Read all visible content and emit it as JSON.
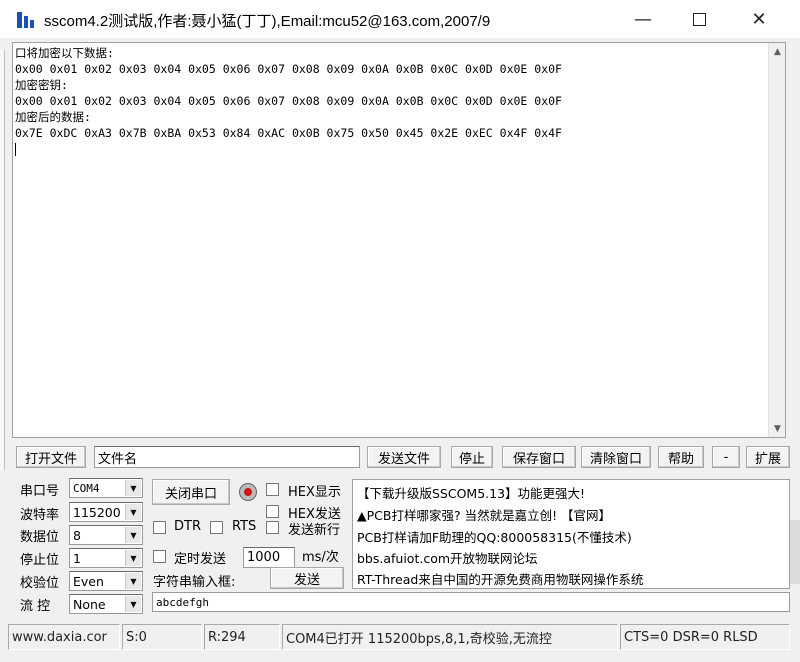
{
  "window": {
    "title": "sscom4.2测试版,作者:聂小猛(丁丁),Email:mcu52@163.com,2007/9",
    "min_glyph": "—",
    "close_glyph": "✕"
  },
  "terminal": {
    "lines": [
      "口将加密以下数据:",
      "0x00 0x01 0x02 0x03 0x04 0x05 0x06 0x07 0x08 0x09 0x0A 0x0B 0x0C 0x0D 0x0E 0x0F",
      "加密密钥:",
      "0x00 0x01 0x02 0x03 0x04 0x05 0x06 0x07 0x08 0x09 0x0A 0x0B 0x0C 0x0D 0x0E 0x0F",
      "加密后的数据:",
      "0x7E 0xDC 0xA3 0x7B 0xBA 0x53 0x84 0xAC 0x0B 0x75 0x50 0x45 0x2E 0xEC 0x4F 0x4F"
    ]
  },
  "toolbar": {
    "open_file": "打开文件",
    "filename": "文件名",
    "send_file": "发送文件",
    "stop": "停止",
    "save_window": "保存窗口",
    "clear_window": "清除窗口",
    "help": "帮助",
    "minus": "-",
    "expand": "扩展"
  },
  "serial": {
    "port_label": "串口号",
    "port_value": "COM4",
    "baud_label": "波特率",
    "baud_value": "115200",
    "databits_label": "数据位",
    "databits_value": "8",
    "stopbits_label": "停止位",
    "stopbits_value": "1",
    "parity_label": "校验位",
    "parity_value": "Even",
    "flow_label": "流 控",
    "flow_value": "None"
  },
  "controls": {
    "close_port": "关闭串口",
    "hex_display": "HEX显示",
    "hex_send": "HEX发送",
    "dtr": "DTR",
    "rts": "RTS",
    "send_newline": "发送新行",
    "timed_send": "定时发送",
    "interval": "1000",
    "interval_unit": "ms/次",
    "string_input": "字符串输入框:",
    "send": "发送",
    "send_text": "abcdefgh"
  },
  "info": {
    "lines": [
      "【下载升级版SSCOM5.13】功能更强大!",
      "▲PCB打样哪家强? 当然就是嘉立创! 【官网】",
      "PCB打样请加F助理的QQ:800058315(不懂技术)",
      "bbs.afuiot.com开放物联网论坛",
      "RT-Thread来自中国的开源免费商用物联网操作系统"
    ]
  },
  "status": {
    "website": "www.daxia.cor",
    "sent": "S:0",
    "received": "R:294",
    "port_state": "COM4已打开  115200bps,8,1,奇校验,无流控",
    "signals": "CTS=0 DSR=0 RLSD"
  },
  "colors": {
    "led": "#d01515",
    "background": "#f0f0f0"
  }
}
